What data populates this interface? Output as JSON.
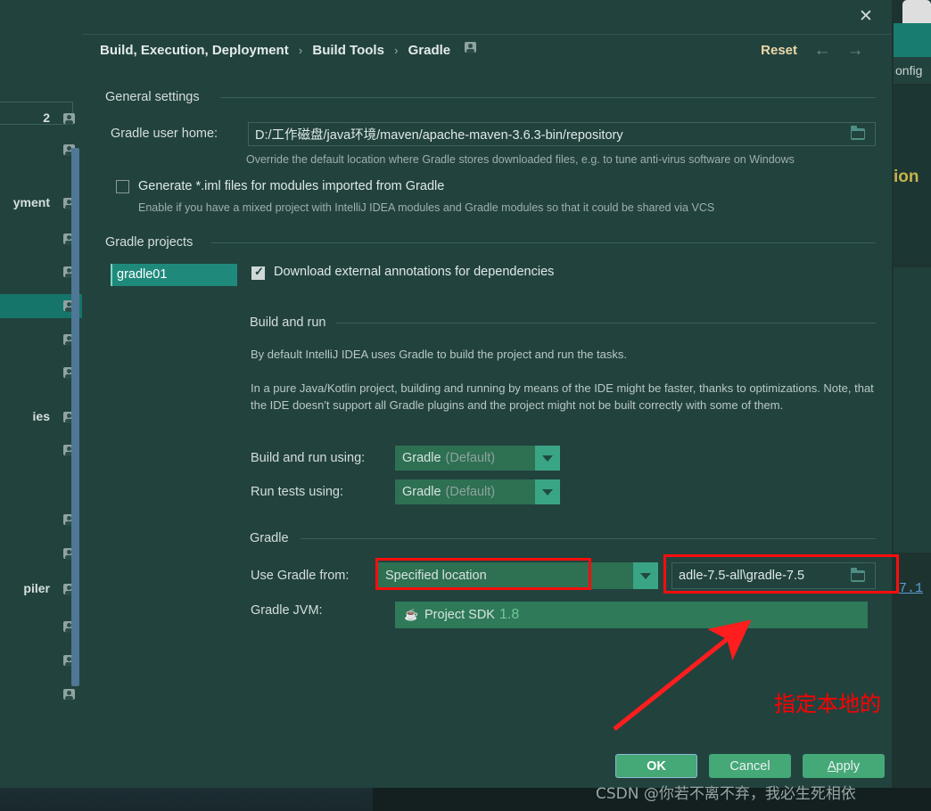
{
  "background": {
    "config_text": "onfig",
    "ion_text": "ion",
    "link_text": "7.1"
  },
  "tree": {
    "rows": [
      {
        "label": "2"
      },
      {
        "label": ""
      },
      {
        "label": "yment"
      },
      {
        "label": ""
      },
      {
        "label": ""
      },
      {
        "label": "",
        "selected": true
      },
      {
        "label": ""
      },
      {
        "label": ""
      },
      {
        "label": "ies"
      },
      {
        "label": ""
      },
      {
        "label": ""
      },
      {
        "label": ""
      },
      {
        "label": "piler"
      },
      {
        "label": ""
      },
      {
        "label": ""
      },
      {
        "label": ""
      }
    ]
  },
  "dialog": {
    "close_label": "✕",
    "breadcrumb": {
      "part1": "Build, Execution, Deployment",
      "part2": "Build Tools",
      "part3": "Gradle",
      "separator": "›"
    },
    "reset_label": "Reset",
    "nav_back": "←",
    "nav_forward": "→"
  },
  "general": {
    "section_title": "General settings",
    "user_home_label": "Gradle user home:",
    "user_home_value": "D:/工作磁盘/java环境/maven/apache-maven-3.6.3-bin/repository",
    "user_home_hint": "Override the default location where Gradle stores downloaded files, e.g. to tune anti-virus software on Windows",
    "iml_checkbox_label": "Generate *.iml files for modules imported from Gradle",
    "iml_checkbox_checked": false,
    "iml_hint": "Enable if you have a mixed project with IntelliJ IDEA modules and Gradle modules so that it could be shared via VCS"
  },
  "projects": {
    "section_title": "Gradle projects",
    "items": [
      "gradle01"
    ],
    "download_annotations_label": "Download external annotations for dependencies",
    "download_annotations_checked": true
  },
  "build_and_run": {
    "section_title": "Build and run",
    "para1": "By default IntelliJ IDEA uses Gradle to build the project and run the tasks.",
    "para2": "In a pure Java/Kotlin project, building and running by means of the IDE might be faster, thanks to optimizations. Note, that the IDE doesn't support all Gradle plugins and the project might not be built correctly with some of them.",
    "build_using_label": "Build and run using:",
    "build_using_value": "Gradle",
    "build_using_suffix": "(Default)",
    "run_tests_label": "Run tests using:",
    "run_tests_value": "Gradle",
    "run_tests_suffix": "(Default)"
  },
  "gradle": {
    "section_title": "Gradle",
    "use_gradle_from_label": "Use Gradle from:",
    "use_gradle_from_value": "Specified location",
    "gradle_home_value": "adle-7.5-all\\gradle-7.5",
    "jvm_label": "Gradle JVM:",
    "jvm_value": "Project SDK",
    "jvm_version": "1.8",
    "java_icon_glyph": "☕"
  },
  "annotations": {
    "chinese_note": "指定本地的",
    "watermark": "CSDN @你若不离不弃，我必生死相依",
    "highlight_color": "#fb0d0d"
  },
  "footer": {
    "ok_label": "OK",
    "cancel_label": "Cancel",
    "apply_label_first": "A",
    "apply_label_rest": "pply"
  }
}
